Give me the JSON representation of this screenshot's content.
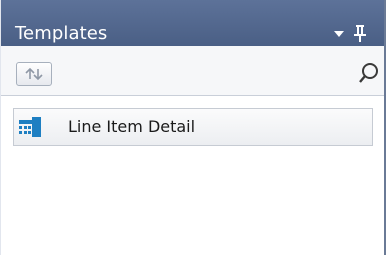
{
  "panel": {
    "title": "Templates",
    "dropdown_icon": "chevron-down-icon",
    "pin_icon": "pin-icon"
  },
  "toolbar": {
    "sort_icon": "sort-up-down-icon",
    "search": {
      "value": "",
      "placeholder": ""
    },
    "search_icon": "search-icon"
  },
  "templates": {
    "items": [
      {
        "label": "Line Item Detail",
        "icon": "grid-table-icon"
      }
    ]
  },
  "colors": {
    "titlebar": "#4f6489",
    "item_icon": "#1e7fc2"
  }
}
